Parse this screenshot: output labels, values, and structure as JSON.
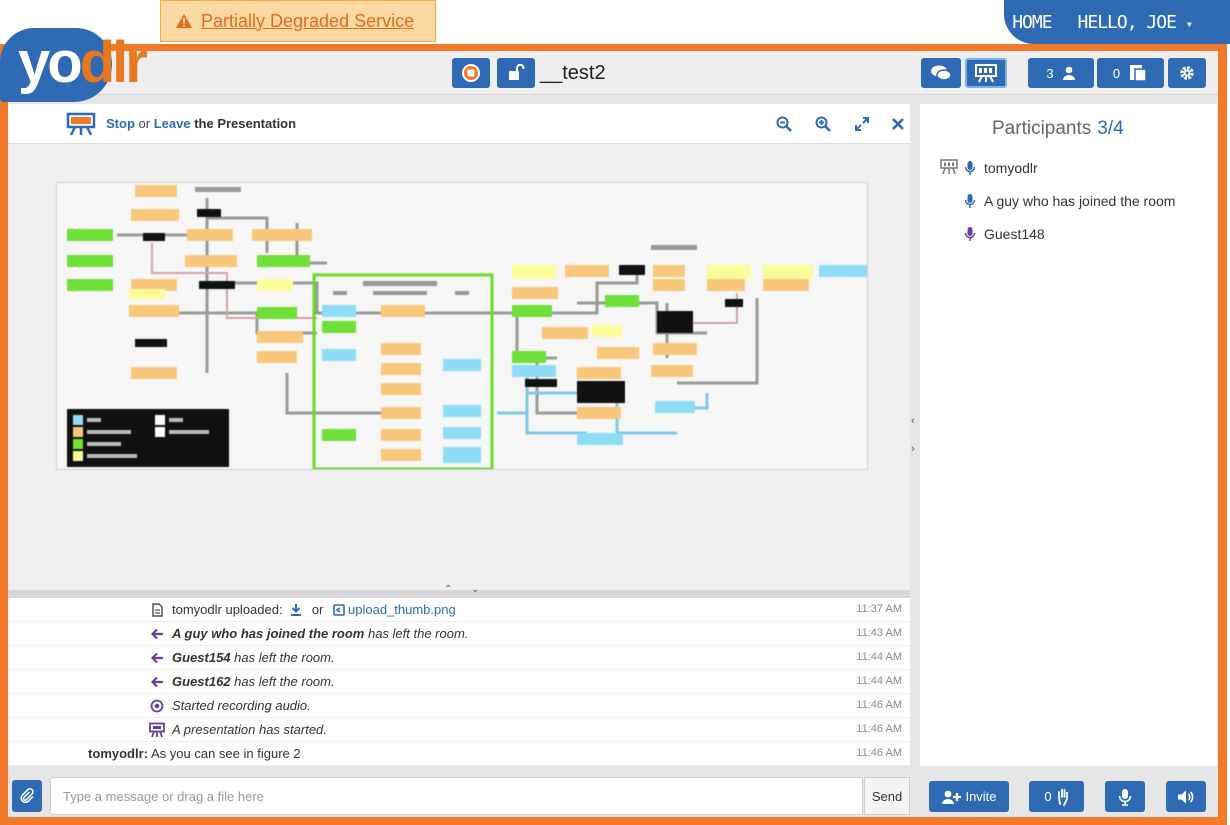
{
  "alert": {
    "text": "Partially Degraded Service"
  },
  "nav": {
    "home": "HOME",
    "greeting": "HELLO, JOE",
    "caret": "▾"
  },
  "logo": {
    "part1": "yo",
    "part2": "dlr"
  },
  "toolbar": {
    "room_name": "__test2",
    "participants_count": "3",
    "files_count": "0"
  },
  "presentation": {
    "stop_label": "Stop",
    "or_label": "or",
    "leave_label": "Leave",
    "suffix": "the Presentation"
  },
  "chat": {
    "messages": [
      {
        "icon": "file-icon",
        "user": "tomyodlr",
        "text": " uploaded: ",
        "or": "or",
        "file": "upload_thumb.png",
        "time": "11:37 AM"
      },
      {
        "icon": "leave-arrow-icon",
        "user": "A guy who has joined the room",
        "text": " has left the room.",
        "time": "11:43 AM"
      },
      {
        "icon": "leave-arrow-icon",
        "user": "Guest154",
        "text": " has left the room.",
        "time": "11:44 AM"
      },
      {
        "icon": "leave-arrow-icon",
        "user": "Guest162",
        "text": " has left the room.",
        "time": "11:44 AM"
      },
      {
        "icon": "record-icon",
        "text": "Started recording audio.",
        "time": "11:46 AM"
      },
      {
        "icon": "presentation-icon",
        "text": "A presentation has started.",
        "time": "11:46 AM"
      },
      {
        "sender": "tomyodlr:",
        "text": "As you can see in figure 2",
        "time": "11:46 AM"
      }
    ]
  },
  "composer": {
    "placeholder": "Type a message or drag a file here",
    "send": "Send"
  },
  "participants": {
    "title": "Participants",
    "count": "3/4",
    "list": [
      {
        "name": "tomyodlr",
        "presenter": true
      },
      {
        "name": "A guy who has joined the room",
        "presenter": false
      },
      {
        "name": "Guest148",
        "presenter": false
      }
    ]
  },
  "bottom_right": {
    "invite": "Invite",
    "hands": "0"
  },
  "colors": {
    "accent": "#2e6bb4",
    "frame": "#f07a2a",
    "alert_bg": "#fcd9a3"
  }
}
